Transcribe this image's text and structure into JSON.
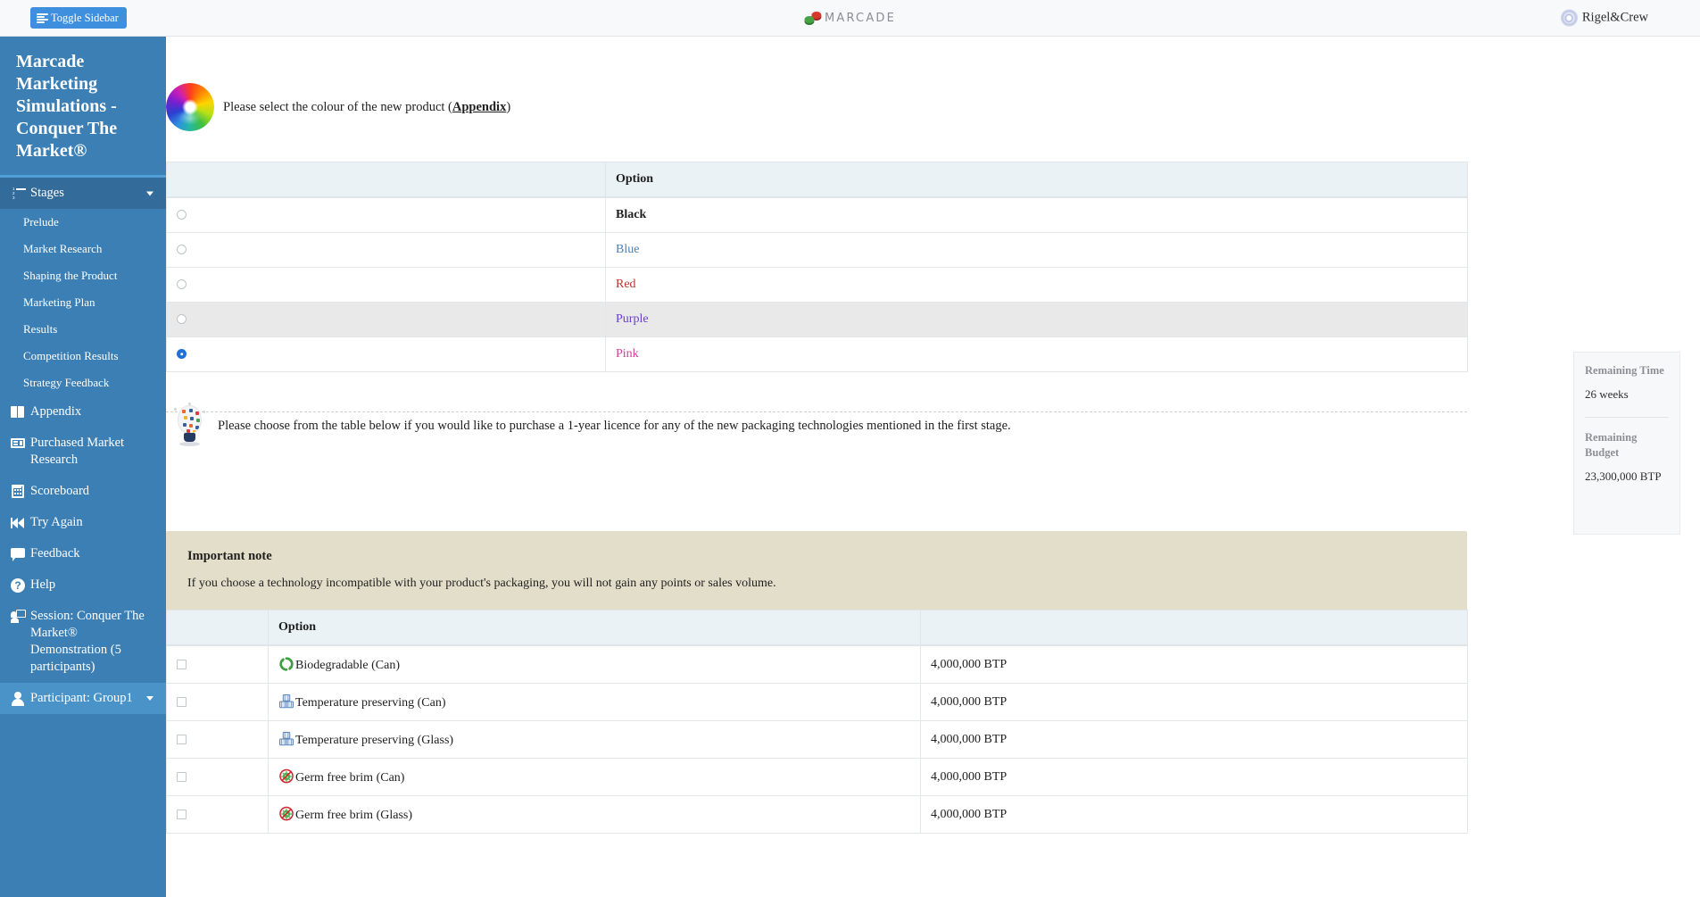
{
  "topbar": {
    "toggle_sidebar_label": "Toggle Sidebar",
    "brand_name": "MARCADE",
    "user_name": "Rigel&Crew"
  },
  "sidebar": {
    "title": "Marcade Marketing Simulations - Conquer The Market®",
    "stages_label": "Stages",
    "stages": [
      {
        "label": "Prelude"
      },
      {
        "label": "Market Research"
      },
      {
        "label": "Shaping the Product"
      },
      {
        "label": "Marketing Plan"
      },
      {
        "label": "Results"
      },
      {
        "label": "Competition Results"
      },
      {
        "label": "Strategy Feedback"
      }
    ],
    "items": [
      {
        "label": "Appendix",
        "icon": "book-icon"
      },
      {
        "label": "Purchased Market Research",
        "icon": "card-icon"
      },
      {
        "label": "Scoreboard",
        "icon": "calculator-icon"
      },
      {
        "label": "Try Again",
        "icon": "rewind-icon"
      },
      {
        "label": "Feedback",
        "icon": "comment-icon"
      },
      {
        "label": "Help",
        "icon": "question-circle-icon"
      },
      {
        "label": "Session: Conquer The Market® Demonstration (5 participants)",
        "icon": "presentation-icon"
      }
    ],
    "participant": {
      "label": "Participant: Group1",
      "icon": "user-icon"
    }
  },
  "main": {
    "colour_prompt": {
      "text_before": "Please select the colour of the new product (",
      "link": "Appendix",
      "text_after": ")"
    },
    "colour_table": {
      "header_option": "Option",
      "rows": [
        {
          "option": "Black",
          "colour": "#1f1f1f",
          "bold": true,
          "selected": false,
          "hover": false
        },
        {
          "option": "Blue",
          "colour": "#4a82b8",
          "bold": false,
          "selected": false,
          "hover": false
        },
        {
          "option": "Red",
          "colour": "#b1382c",
          "bold": false,
          "selected": false,
          "hover": false
        },
        {
          "option": "Purple",
          "colour": "#6a3fcf",
          "bold": false,
          "selected": false,
          "hover": true
        },
        {
          "option": "Pink",
          "colour": "#d4409a",
          "bold": false,
          "selected": true,
          "hover": false
        }
      ]
    },
    "licence_prompt": "Please choose from the table below if you would like to purchase a 1-year licence for any of the new packaging technologies mentioned in the first stage.",
    "note": {
      "title": "Important note",
      "body": "If you choose a technology incompatible with your product's packaging, you will not gain any points or sales volume."
    },
    "tech_table": {
      "header_option": "Option",
      "header_price": "",
      "rows": [
        {
          "option": "Biodegradable (Can)",
          "icon": "recycle-icon",
          "price": "4,000,000 BTP",
          "checked": false
        },
        {
          "option": "Temperature preserving (Can)",
          "icon": "crate-icon",
          "price": "4,000,000 BTP",
          "checked": false
        },
        {
          "option": "Temperature preserving (Glass)",
          "icon": "crate-icon",
          "price": "4,000,000 BTP",
          "checked": false
        },
        {
          "option": "Germ free brim (Can)",
          "icon": "germ-free-icon",
          "price": "4,000,000 BTP",
          "checked": false
        },
        {
          "option": "Germ free brim (Glass)",
          "icon": "germ-free-icon",
          "price": "4,000,000 BTP",
          "checked": false
        }
      ]
    }
  },
  "info_card": {
    "time_label": "Remaining Time",
    "time_value": "26 weeks",
    "budget_label": "Remaining Budget",
    "budget_value": "23,300,000 BTP"
  },
  "colors": {
    "sidebar_bg": "#3b7fb5",
    "sidebar_active": "#4a93c9",
    "accent_blue": "#3f8fdf",
    "table_header": "#eaf2f5",
    "note_bg": "#e3dec9"
  }
}
